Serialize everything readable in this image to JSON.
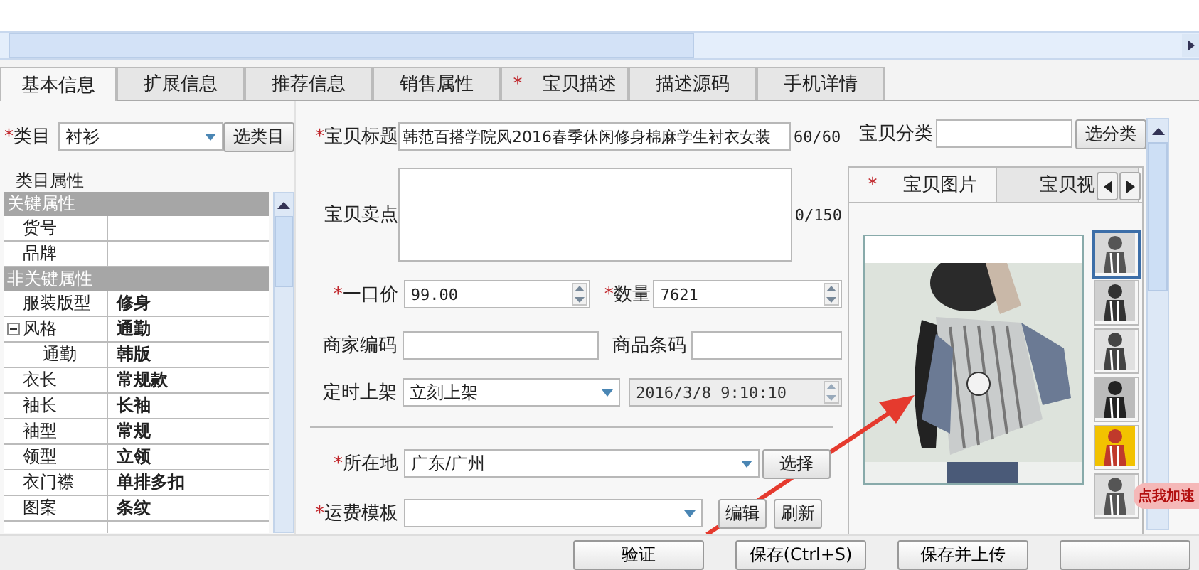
{
  "tabs": [
    {
      "label": "基本信息",
      "selected": true
    },
    {
      "label": "扩展信息",
      "selected": false
    },
    {
      "label": "推荐信息",
      "selected": false
    },
    {
      "label": "销售属性",
      "selected": false
    },
    {
      "label": "宝贝描述",
      "selected": false,
      "mark": "*"
    },
    {
      "label": "描述源码",
      "selected": false
    },
    {
      "label": "手机详情",
      "selected": false
    }
  ],
  "category": {
    "mark": "*",
    "label": "类目",
    "value": "衬衫",
    "button": "选类目"
  },
  "attributes": {
    "title": "类目属性",
    "groups": [
      {
        "name": "关键属性",
        "rows": [
          {
            "name": "货号"
          },
          {
            "name": "品牌"
          }
        ]
      },
      {
        "name": "非关键属性",
        "rows": [
          {
            "name": "服装版型",
            "value": "修身"
          },
          {
            "name": "风格",
            "value": "通勤",
            "expanded": true,
            "children": [
              {
                "name": "通勤",
                "value": "韩版"
              }
            ]
          },
          {
            "name": "衣长",
            "value": "常规款"
          },
          {
            "name": "袖长",
            "value": "长袖"
          },
          {
            "name": "袖型",
            "value": "常规"
          },
          {
            "name": "领型",
            "value": "立领"
          },
          {
            "name": "衣门襟",
            "value": "单排多扣"
          },
          {
            "name": "图案",
            "value": "条纹"
          }
        ]
      }
    ]
  },
  "title_field": {
    "mark": "*",
    "label": "宝贝标题",
    "value": "韩范百搭学院风2016春季休闲修身棉麻学生衬衣女装",
    "counter": "60/60"
  },
  "selling_point": {
    "label": "宝贝卖点",
    "counter": "0/150"
  },
  "price": {
    "mark": "*",
    "label": "一口价",
    "value": "99.00"
  },
  "quantity": {
    "mark": "*",
    "label": "数量",
    "value": "7621"
  },
  "merchant_code": {
    "label": "商家编码"
  },
  "barcode": {
    "label": "商品条码"
  },
  "listing": {
    "label": "定时上架",
    "value": "立刻上架",
    "datetime": "2016/3/8 9:10:10",
    "datetime_disabled": true
  },
  "location": {
    "mark": "*",
    "label": "所在地",
    "value": "广东/广州",
    "button": "选择"
  },
  "freight": {
    "mark": "*",
    "label": "运费模板",
    "buttons": [
      "编辑",
      "刷新"
    ]
  },
  "item_category": {
    "label": "宝贝分类",
    "button": "选分类"
  },
  "media_tabs": [
    {
      "label": "宝贝图片",
      "selected": true,
      "mark": "*"
    },
    {
      "label": "宝贝视",
      "selected": false
    }
  ],
  "thumbnails": [
    {
      "selected": true
    },
    {
      "selected": false
    },
    {
      "selected": false
    },
    {
      "selected": false
    },
    {
      "selected": false
    },
    {
      "selected": false
    }
  ],
  "bottom_buttons": [
    "验证",
    "保存(Ctrl+S)",
    "保存并上传"
  ],
  "speed_badge": "点我加速"
}
